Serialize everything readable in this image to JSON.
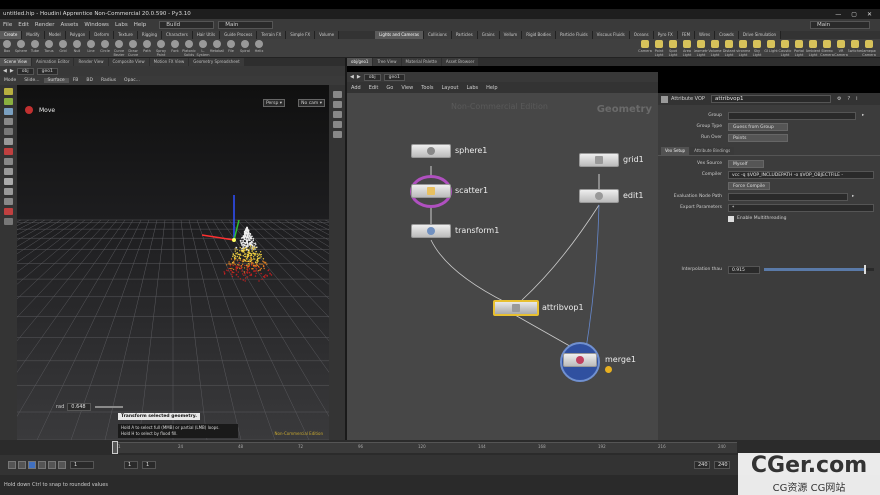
{
  "window": {
    "title": "untitled.hip - Houdini Apprentice Non-Commercial 20.0.590 - Py3.10",
    "controls": [
      "—",
      "▢",
      "✕"
    ]
  },
  "menubar": {
    "items": [
      "File",
      "Edit",
      "Render",
      "Assets",
      "Windows",
      "Labs",
      "Help"
    ],
    "desktop": "Build",
    "main": "Main",
    "main_right": "Main"
  },
  "shelf_tabs": {
    "left": [
      "Create",
      "Modify",
      "Model",
      "Polygon",
      "Deform",
      "Texture",
      "Rigging",
      "Characters",
      "Hair Utils",
      "Guide Process",
      "Terrain FX",
      "Simple FX",
      "Volume"
    ],
    "right": [
      "Lights and Cameras",
      "Collisions",
      "Particles",
      "Grains",
      "Vellum",
      "Rigid Bodies",
      "Particle Fluids",
      "Viscous Fluids",
      "Oceans",
      "Pyro FX",
      "FEM",
      "Wires",
      "Crowds",
      "Drive Simulation"
    ]
  },
  "shelf_tools": {
    "left": [
      "Box",
      "Sphere",
      "Tube",
      "Torus",
      "Grid",
      "Null",
      "Line",
      "Circle",
      "Curve Bezier",
      "Draw Curve",
      "Path",
      "Spray Paint",
      "Font",
      "Platonic Solids",
      "L-System",
      "Metaball",
      "File",
      "Spiral",
      "Helix"
    ],
    "right": [
      "Camera",
      "Point Light",
      "Spot Light",
      "Area Light",
      "Geometry Light",
      "Volume Light",
      "Distant Light",
      "Environment Light",
      "Sky Light",
      "GI Light",
      "Caustic Light",
      "Portal Light",
      "Ambient Light",
      "Stereo Camera",
      "VR Camera",
      "Switcher",
      "Gamepad Camera"
    ]
  },
  "left_pane": {
    "tabs": [
      "Scene View",
      "Animation Editor",
      "Render View",
      "Composite View",
      "Motion FX View",
      "Geometry Spreadsheet"
    ],
    "path": [
      "obj",
      "geo1"
    ],
    "toolbar": [
      "Mode",
      "Slide...",
      "Surface",
      "FB",
      "BD",
      "Radius",
      "Opac..."
    ],
    "tool_name": "Move",
    "persp": "Persp ▾",
    "cam": "No cam ▾",
    "rad_label": "rad",
    "rad_value": "0.648",
    "hint_title": "Transform selected geometry.",
    "hint_lines": [
      "Hold A to select full (MMB) or partial (LMB) loops.",
      "Hold H to select by flood fill."
    ],
    "watermark_small": "Non-Commercial Edition"
  },
  "right_pane": {
    "tabs": [
      "obj/geo1",
      "Tree View",
      "Material Palette",
      "Asset Browser"
    ],
    "path": [
      "obj",
      "geo1"
    ],
    "menu": [
      "Add",
      "Edit",
      "Go",
      "View",
      "Tools",
      "Layout",
      "Labs",
      "Help"
    ],
    "watermark": "Non-Commercial Edition",
    "context": "Geometry",
    "nodes": {
      "sphere": "sphere1",
      "scatter": "scatter1",
      "transform": "transform1",
      "grid": "grid1",
      "edit": "edit1",
      "attribvop": "attribvop1",
      "merge": "merge1"
    }
  },
  "params": {
    "type": "Attribute VOP",
    "name": "attribvop1",
    "group_label": "Group",
    "group_value": "",
    "group_type_label": "Group Type",
    "group_type": "Guess from Group",
    "run_over_label": "Run Over",
    "run_over": "Points",
    "tabs": [
      "Vex Setup",
      "Attribute Bindings"
    ],
    "vex_source_label": "Vex Source",
    "vex_source": "Myself",
    "compiler_label": "Compiler",
    "compiler": "vcc -q $VOP_INCLUDEPATH -o $VOP_OBJECTFILE -",
    "force_compile": "Force Compile",
    "eval_path_label": "Evaluation Node Path",
    "export_label": "Export Parameters",
    "export_value": "*",
    "multithread": "Enable Multithreading",
    "interp_label": "Interpolation thau",
    "interp_value": "0.915",
    "interp_fraction": 0.915
  },
  "timeline": {
    "ticks": [
      "1",
      "24",
      "48",
      "72",
      "96",
      "120",
      "144",
      "168",
      "192",
      "216",
      "240"
    ],
    "end_label": "240"
  },
  "playbar": {
    "frame": "1",
    "start": "1",
    "start2": "1",
    "end": "240",
    "end2": "240"
  },
  "status": {
    "text": "Hold down Ctrl to snap to rounded values"
  },
  "watermark": {
    "main": "CGer.com",
    "sub": "CG资源 CG网站"
  }
}
